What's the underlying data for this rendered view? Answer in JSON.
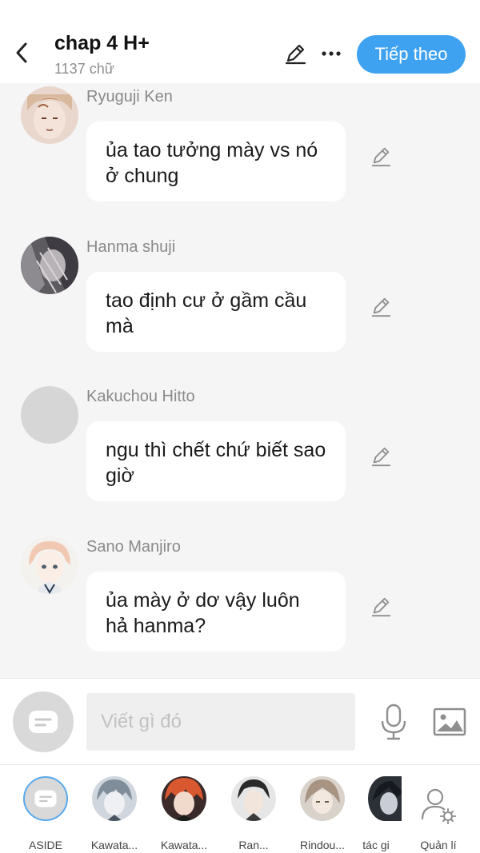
{
  "header": {
    "title": "chap 4 H+",
    "subtitle": "1137 chữ",
    "next_label": "Tiếp theo"
  },
  "messages": [
    {
      "sender": "Ryuguji Ken",
      "text": "ủa tao tưởng mày vs nó ở chung",
      "avatar": "avatar-ryuguji-ken"
    },
    {
      "sender": "Hanma shuji",
      "text": "tao định cư ở gầm cầu mà",
      "avatar": "avatar-hanma-shuji"
    },
    {
      "sender": "Kakuchou Hitto",
      "text": "ngu thì chết chứ biết sao giờ",
      "avatar": "avatar-placeholder"
    },
    {
      "sender": "Sano Manjiro",
      "text": "ủa mày ở dơ vậy luôn hả hanma?",
      "avatar": "avatar-sano-manjiro"
    }
  ],
  "composer": {
    "placeholder": "Viết gì đó"
  },
  "characters": [
    {
      "label": "ASIDE",
      "active": true
    },
    {
      "label": "Kawata...",
      "active": false
    },
    {
      "label": "Kawata...",
      "active": false
    },
    {
      "label": "Ran...",
      "active": false
    },
    {
      "label": "Rindou...",
      "active": false
    },
    {
      "label": "tác gi",
      "active": false
    }
  ],
  "manage_label": "Quản lí",
  "colors": {
    "accent": "#3fa2f0",
    "background": "#f5f5f5",
    "bubble": "#ffffff"
  }
}
